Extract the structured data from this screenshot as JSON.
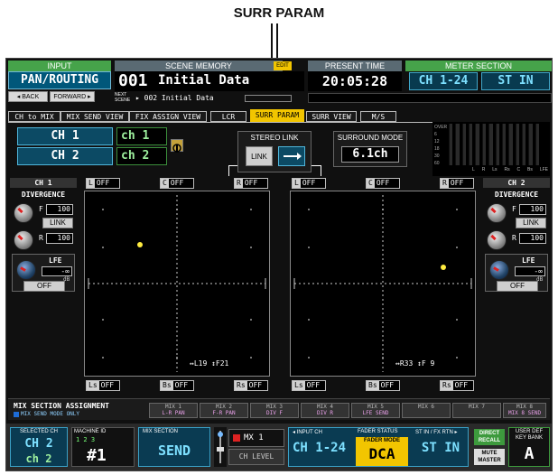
{
  "callout": {
    "label": "SURR PARAM"
  },
  "header": {
    "input_label": "INPUT",
    "function_name": "PAN/ROUTING",
    "back_label": "◂ BACK",
    "forward_label": "FORWARD ▸",
    "scene_memory_label": "SCENE MEMORY",
    "edit_badge": "EDIT",
    "scene_number": "001",
    "scene_title": "Initial Data",
    "next_scene_label": "NEXT SCENE",
    "next_scene_value": "▸ 002 Initial Data",
    "present_time_label": "PRESENT TIME",
    "present_time": "20:05:28",
    "meter_section_label": "METER SECTION",
    "meter_left": "CH 1-24",
    "meter_right": "ST IN"
  },
  "tabs": [
    {
      "label": "CH to MIX"
    },
    {
      "label": "MIX SEND VIEW"
    },
    {
      "label": "FIX ASSIGN VIEW"
    },
    {
      "label": "LCR"
    },
    {
      "label": "SURR PARAM"
    },
    {
      "label": "SURR VIEW"
    },
    {
      "label": "M/S"
    }
  ],
  "channels": {
    "ch_a": "CH 1",
    "ch_a_name": "ch 1",
    "ch_b": "CH 2",
    "ch_b_name": "ch 2"
  },
  "stereo_link": {
    "title": "STEREO LINK",
    "link_label": "LINK"
  },
  "surround_mode": {
    "title": "SURROUND MODE",
    "value": "6.1ch"
  },
  "mini_meter": {
    "scale": [
      "OVER",
      "6",
      "12",
      "18",
      "30",
      "60"
    ],
    "labels": [
      "L",
      "R",
      "Ls",
      "Rs",
      "C",
      "Bs",
      "LFE"
    ]
  },
  "left_strip": {
    "ch": "CH 1",
    "divergence": "DIVERGENCE",
    "f_label": "F",
    "f_value": "100",
    "link": "LINK",
    "r_label": "R",
    "r_value": "100",
    "lfe": "LFE",
    "lfe_value": "-∞",
    "lfe_unit": "dB",
    "off": "OFF"
  },
  "right_strip": {
    "ch": "CH 2",
    "divergence": "DIVERGENCE",
    "f_label": "F",
    "f_value": "100",
    "link": "LINK",
    "r_label": "R",
    "r_value": "100",
    "lfe": "LFE",
    "lfe_value": "-∞",
    "lfe_unit": "dB",
    "off": "OFF"
  },
  "pad_left": {
    "top": [
      {
        "k": "L",
        "v": "OFF"
      },
      {
        "k": "C",
        "v": "OFF"
      },
      {
        "k": "R",
        "v": "OFF"
      }
    ],
    "bottom": [
      {
        "k": "Ls",
        "v": "OFF"
      },
      {
        "k": "Bs",
        "v": "OFF"
      },
      {
        "k": "Rs",
        "v": "OFF"
      }
    ],
    "readout": "↔L19 ↕F21",
    "dot_x": 0.3,
    "dot_y": 0.29
  },
  "pad_right": {
    "top": [
      {
        "k": "L",
        "v": "OFF"
      },
      {
        "k": "C",
        "v": "OFF"
      },
      {
        "k": "R",
        "v": "OFF"
      }
    ],
    "bottom": [
      {
        "k": "Ls",
        "v": "OFF"
      },
      {
        "k": "Bs",
        "v": "OFF"
      },
      {
        "k": "Rs",
        "v": "OFF"
      }
    ],
    "readout": "↔R33 ↕F 9",
    "dot_x": 0.83,
    "dot_y": 0.41
  },
  "mix_assign": {
    "title": "MIX SECTION ASSIGNMENT",
    "subtitle": "MIX SEND MODE ONLY",
    "cells": [
      {
        "name": "MIX 1",
        "sub": "L-R PAN"
      },
      {
        "name": "MIX 2",
        "sub": "F-R PAN"
      },
      {
        "name": "MIX 3",
        "sub": "DIV F"
      },
      {
        "name": "MIX 4",
        "sub": "DIV R"
      },
      {
        "name": "MIX 5",
        "sub": "LFE SEND"
      },
      {
        "name": "MIX 6",
        "sub": ""
      },
      {
        "name": "MIX 7",
        "sub": ""
      },
      {
        "name": "MIX 8",
        "sub": "MIX 8 SEND"
      }
    ]
  },
  "footer": {
    "selected_ch_label": "SELECTED CH",
    "selected_ch": "CH 2",
    "selected_ch_name": "ch 2",
    "machine_id_label": "MACHINE ID",
    "machine_digits": "1 2 3",
    "machine_num": "#1",
    "mix_section_label": "MIX SECTION",
    "mix_section_value": "SEND",
    "mix_label": "MX 1",
    "ch_level": "CH LEVEL",
    "input_ch_label": "◂ INPUT CH",
    "input_ch": "CH 1-24",
    "fader_status_label": "FADER STATUS",
    "fader_mode_label": "FADER MODE",
    "fader_mode": "DCA",
    "st_in_label": "ST IN / FX RTN ▸",
    "st_in": "ST IN",
    "direct_recall": "DIRECT RECALL",
    "mute_master": "MUTE MASTER",
    "user_def_label": "USER DEF KEY BANK",
    "user_def_value": "A"
  }
}
